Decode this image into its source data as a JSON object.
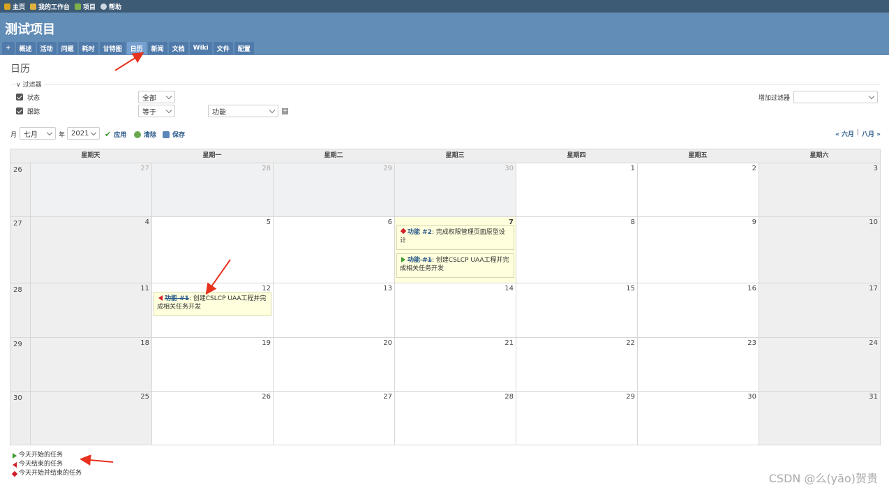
{
  "top_menu": [
    {
      "label": "主页",
      "icon": "home-icon",
      "color": "#d9a520"
    },
    {
      "label": "我的工作台",
      "icon": "user-icon",
      "color": "#e0b040"
    },
    {
      "label": "项目",
      "icon": "projects-icon",
      "color": "#7fb04a"
    },
    {
      "label": "帮助",
      "icon": "help-icon",
      "color": "#cfd8e3"
    }
  ],
  "project_title": "测试项目",
  "main_menu": [
    {
      "label": "+"
    },
    {
      "label": "概述"
    },
    {
      "label": "活动"
    },
    {
      "label": "问题"
    },
    {
      "label": "耗时"
    },
    {
      "label": "甘特图"
    },
    {
      "label": "日历",
      "selected": true
    },
    {
      "label": "新闻"
    },
    {
      "label": "文档"
    },
    {
      "label": "Wiki"
    },
    {
      "label": "文件"
    },
    {
      "label": "配置"
    }
  ],
  "page_title": "日历",
  "filters": {
    "legend": "过滤器",
    "status_label": "状态",
    "status_value": "全部",
    "tracker_label": "跟踪",
    "tracker_operator": "等于",
    "tracker_value": "功能",
    "add_filter_label": "增加过滤器",
    "add_filter_value": ""
  },
  "query": {
    "month_label": "月",
    "month_value": "七月",
    "year_label": "年",
    "year_value": "2021",
    "apply": "应用",
    "clear": "清除",
    "save": "保存",
    "prev_month": "« 六月",
    "separator": "|",
    "next_month": "八月 »"
  },
  "calendar": {
    "day_headers": [
      "星期天",
      "星期一",
      "星期二",
      "星期三",
      "星期四",
      "星期五",
      "星期六"
    ],
    "weeks": [
      {
        "week": "26",
        "days": [
          "27",
          "28",
          "29",
          "30",
          "1",
          "2",
          "3"
        ]
      },
      {
        "week": "27",
        "days": [
          "4",
          "5",
          "6",
          "7",
          "8",
          "9",
          "10"
        ]
      },
      {
        "week": "28",
        "days": [
          "11",
          "12",
          "13",
          "14",
          "15",
          "16",
          "17"
        ]
      },
      {
        "week": "29",
        "days": [
          "18",
          "19",
          "20",
          "21",
          "22",
          "23",
          "24"
        ]
      },
      {
        "week": "30",
        "days": [
          "25",
          "26",
          "27",
          "28",
          "29",
          "30",
          "31"
        ]
      }
    ],
    "issues": {
      "wed7_a": {
        "tracker": "功能 #2",
        "subject": ": 完成权限管理页面原型设计"
      },
      "wed7_b": {
        "tracker": "功能 #1",
        "subject": ": 创建CSLCP UAA工程并完成相关任务开发"
      },
      "mon12": {
        "tracker": "功能 #1",
        "subject": ": 创建CSLCP UAA工程并完成相关任务开发"
      }
    }
  },
  "legend": {
    "starts_today": "今天开始的任务",
    "ends_today": "今天结束的任务",
    "starts_and_ends_today": "今天开始并结束的任务"
  },
  "watermark": "CSDN @么(yāo)贺贵"
}
